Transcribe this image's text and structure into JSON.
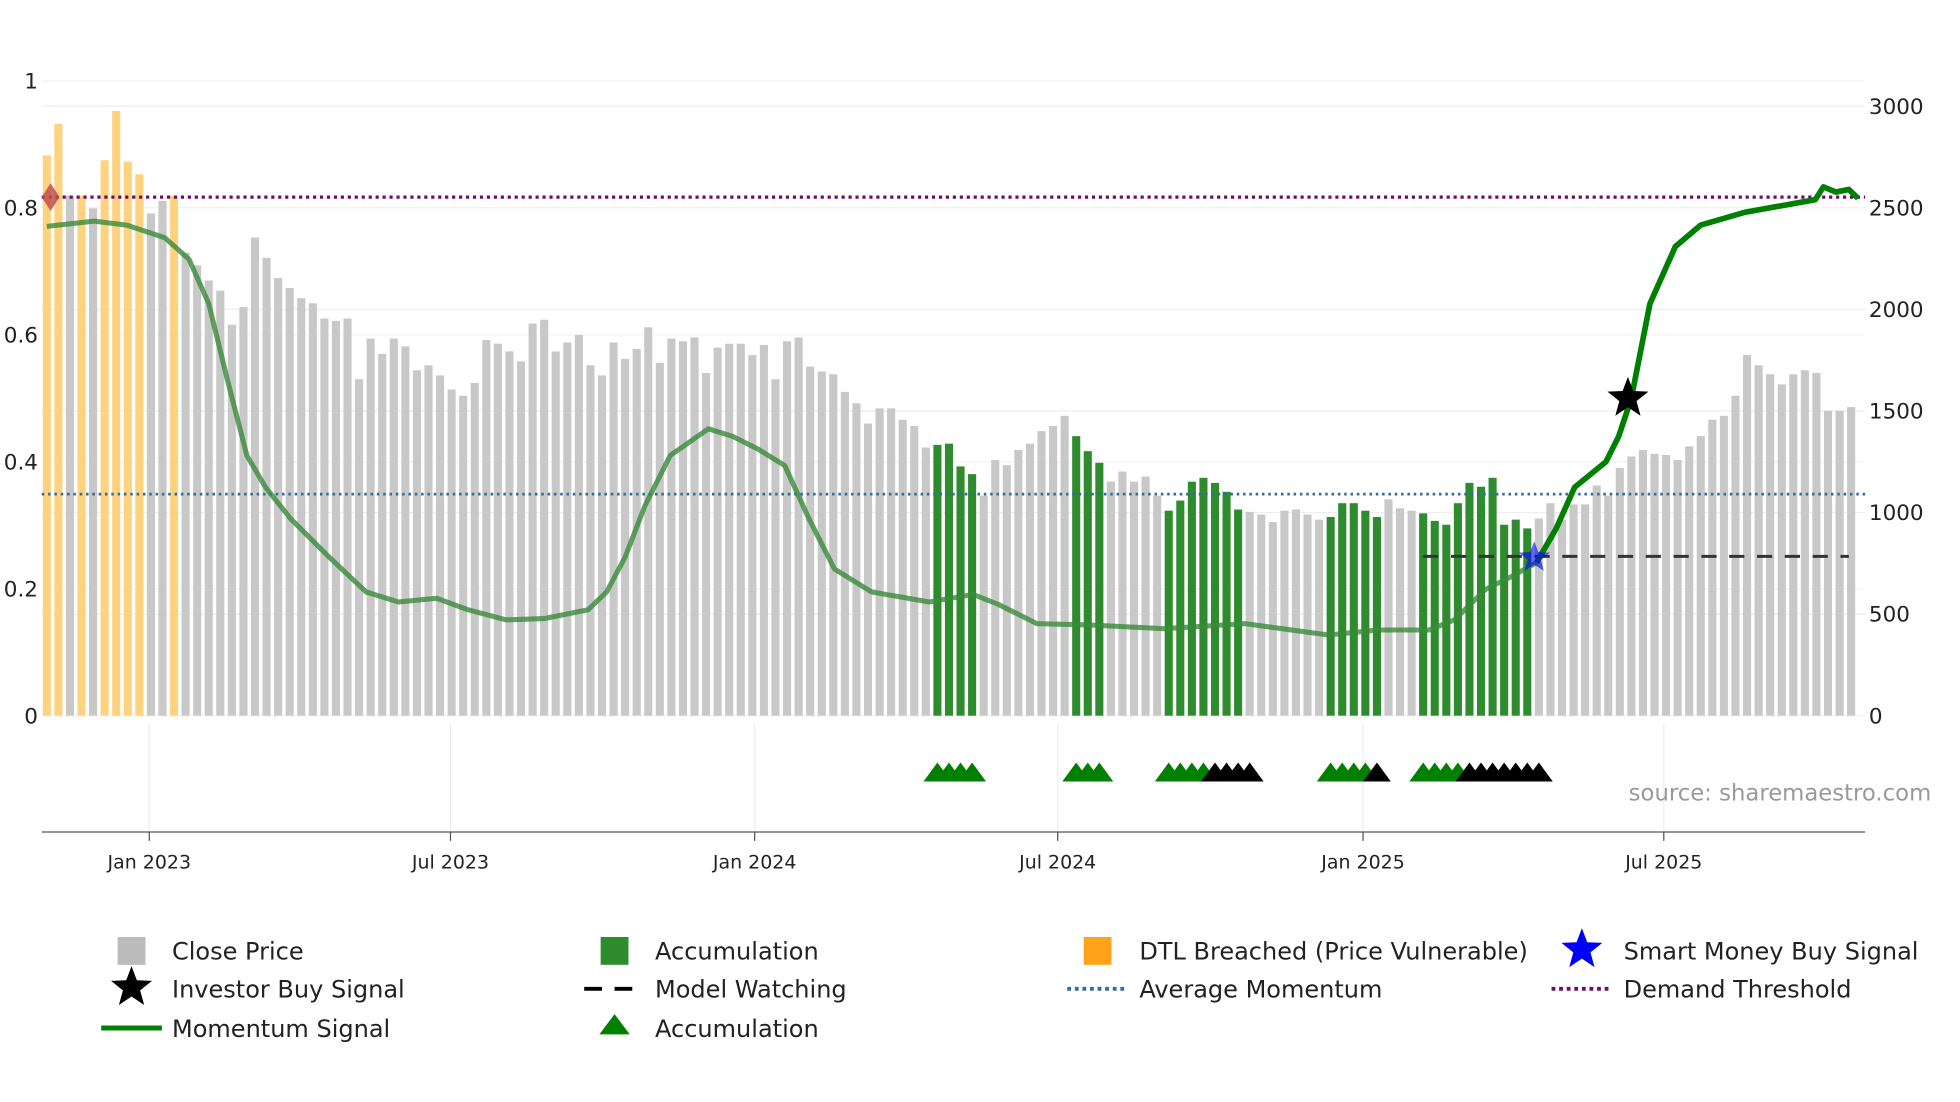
{
  "chart_data": {
    "type": "bar+line",
    "title": "",
    "interval": "weekly",
    "left_axis": {
      "ylim": [
        0,
        1
      ],
      "ticks": [
        "0",
        "0.2",
        "0.4",
        "0.6",
        "0.8",
        "1"
      ],
      "tick_values": [
        0,
        0.2,
        0.4,
        0.6,
        0.8,
        1
      ]
    },
    "right_axis": {
      "ylim": [
        0,
        3000
      ],
      "ticks": [
        "0",
        "500",
        "1000",
        "1500",
        "2000",
        "2500",
        "3000"
      ],
      "tick_values": [
        0,
        500,
        1000,
        1500,
        2000,
        2500,
        3000
      ]
    },
    "x_ticks": [
      {
        "label": "Jan 2023",
        "week": 8.86
      },
      {
        "label": "Jul 2023",
        "week": 34.9
      },
      {
        "label": "Jan 2024",
        "week": 61.2
      },
      {
        "label": "Jul 2024",
        "week": 87.4
      },
      {
        "label": "Jan 2025",
        "week": 113.8
      },
      {
        "label": "Jul 2025",
        "week": 139.8
      }
    ],
    "close_price": [
      2758,
      2914,
      2560,
      2560,
      2497,
      2734,
      2977,
      2727,
      2665,
      2472,
      2534,
      2560,
      2279,
      2217,
      2142,
      2092,
      1924,
      2011,
      2354,
      2254,
      2154,
      2105,
      2055,
      2030,
      1955,
      1943,
      1955,
      1656,
      1856,
      1781,
      1856,
      1818,
      1700,
      1725,
      1675,
      1606,
      1575,
      1638,
      1849,
      1831,
      1793,
      1744,
      1930,
      1949,
      1793,
      1837,
      1874,
      1725,
      1675,
      1837,
      1756,
      1806,
      1912,
      1737,
      1856,
      1843,
      1862,
      1687,
      1812,
      1831,
      1831,
      1775,
      1825,
      1656,
      1843,
      1862,
      1719,
      1694,
      1681,
      1594,
      1538,
      1438,
      1513,
      1513,
      1457,
      1426,
      1320,
      1333,
      1339,
      1227,
      1189,
      1083,
      1258,
      1233,
      1308,
      1339,
      1401,
      1426,
      1476,
      1376,
      1302,
      1245,
      1152,
      1202,
      1152,
      1177,
      1083,
      1009,
      1059,
      1152,
      1171,
      1146,
      1102,
      1015,
      1003,
      990,
      953,
      1009,
      1015,
      990,
      965,
      978,
      1046,
      1046,
      1009,
      978,
      1065,
      1021,
      1009,
      996,
      959,
      940,
      1046,
      1146,
      1127,
      1171,
      940,
      965,
      922,
      971,
      1046,
      965,
      1040,
      1040,
      1133,
      1083,
      1220,
      1276,
      1308,
      1289,
      1283,
      1258,
      1326,
      1376,
      1457,
      1476,
      1575,
      1775,
      1725,
      1681,
      1631,
      1681,
      1700,
      1687,
      1501,
      1501,
      1519
    ],
    "dtl_breached_weeks": [
      0,
      1,
      3,
      5,
      6,
      7,
      8,
      11
    ],
    "accumulation_weeks": [
      77,
      78,
      79,
      80,
      89,
      90,
      91,
      97,
      98,
      99,
      100,
      101,
      102,
      103,
      111,
      112,
      113,
      114,
      115,
      119,
      120,
      121,
      122,
      123,
      124,
      125,
      126,
      127,
      128
    ],
    "momentum_signal": [
      [
        0,
        0.771
      ],
      [
        4.1,
        0.779
      ],
      [
        6.9,
        0.773
      ],
      [
        10.2,
        0.753
      ],
      [
        12.3,
        0.719
      ],
      [
        14.0,
        0.649
      ],
      [
        15.6,
        0.53
      ],
      [
        17.3,
        0.41
      ],
      [
        18.9,
        0.36
      ],
      [
        21.1,
        0.31
      ],
      [
        24.4,
        0.25
      ],
      [
        27.6,
        0.195
      ],
      [
        30.4,
        0.179
      ],
      [
        33.7,
        0.185
      ],
      [
        36.4,
        0.167
      ],
      [
        39.7,
        0.151
      ],
      [
        43.0,
        0.153
      ],
      [
        46.8,
        0.167
      ],
      [
        48.4,
        0.195
      ],
      [
        50.0,
        0.25
      ],
      [
        51.7,
        0.33
      ],
      [
        53.9,
        0.41
      ],
      [
        57.2,
        0.452
      ],
      [
        59.3,
        0.44
      ],
      [
        61.5,
        0.42
      ],
      [
        63.8,
        0.394
      ],
      [
        65.9,
        0.31
      ],
      [
        68.1,
        0.231
      ],
      [
        71.3,
        0.195
      ],
      [
        76.3,
        0.179
      ],
      [
        80.1,
        0.191
      ],
      [
        82.3,
        0.175
      ],
      [
        85.6,
        0.145
      ],
      [
        90.0,
        0.143
      ],
      [
        96.6,
        0.137
      ],
      [
        103.6,
        0.145
      ],
      [
        110.8,
        0.127
      ],
      [
        115.1,
        0.135
      ],
      [
        119.5,
        0.135
      ],
      [
        121.7,
        0.151
      ],
      [
        124.4,
        0.199
      ],
      [
        126.6,
        0.219
      ],
      [
        128.8,
        0.241
      ],
      [
        130.5,
        0.295
      ],
      [
        132.1,
        0.36
      ],
      [
        134.8,
        0.4
      ],
      [
        135.9,
        0.44
      ],
      [
        137.0,
        0.5
      ],
      [
        138.6,
        0.649
      ],
      [
        140.8,
        0.739
      ],
      [
        143.0,
        0.773
      ],
      [
        146.8,
        0.793
      ],
      [
        152.9,
        0.813
      ],
      [
        153.6,
        0.833
      ],
      [
        154.7,
        0.825
      ],
      [
        155.8,
        0.829
      ],
      [
        156.6,
        0.815
      ]
    ],
    "momentum_highlight_from_week": 128.8,
    "demand_threshold": 0.817,
    "average_momentum": 0.349,
    "model_watching": {
      "value": 0.251,
      "from_week": 119,
      "to_week": 155.8
    },
    "smart_money_buy_signal": {
      "week": 128.6,
      "value": 0.249
    },
    "investor_buy_signal": {
      "week": 136.7,
      "value": 0.5
    },
    "threshold_marker": {
      "week": 0,
      "value": 0.817
    },
    "accumulation_markers": {
      "green": [
        77,
        78,
        79,
        80,
        89,
        90,
        91,
        97,
        98,
        99,
        100,
        111,
        112,
        113,
        114,
        119,
        120,
        121,
        122
      ],
      "black": [
        101,
        102,
        103,
        104,
        115,
        123,
        124,
        125,
        126,
        127,
        128,
        129
      ]
    },
    "colors": {
      "price": "#c8c8c8",
      "accumulation": "#2e8b2e",
      "dtl": "#ffd27f",
      "momentum": "#008000",
      "momentum_faded": "#3a8a3a",
      "avg": "#2f6f9f",
      "threshold": "#6a0d6a",
      "smart": "#0000ff",
      "investor": "#000000"
    },
    "legend": [
      {
        "label": "Close Price",
        "icon": "gray-square"
      },
      {
        "label": "Accumulation",
        "icon": "green-square"
      },
      {
        "label": "DTL Breached (Price Vulnerable)",
        "icon": "orange-square"
      },
      {
        "label": "Smart Money Buy Signal",
        "icon": "blue-star"
      },
      {
        "label": "Investor Buy Signal",
        "icon": "black-star"
      },
      {
        "label": "Model Watching",
        "icon": "black-dash"
      },
      {
        "label": "Average Momentum",
        "icon": "blue-dots"
      },
      {
        "label": "Demand Threshold",
        "icon": "purple-dots"
      },
      {
        "label": "Momentum Signal",
        "icon": "green-line"
      },
      {
        "label": "Accumulation",
        "icon": "green-triangle"
      }
    ],
    "source": "source: sharemaestro.com"
  }
}
